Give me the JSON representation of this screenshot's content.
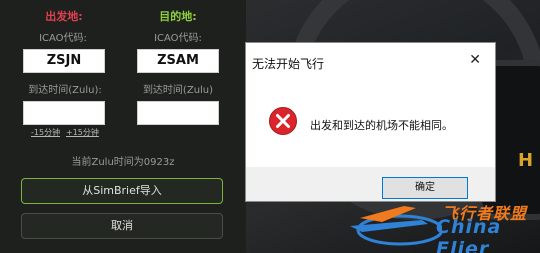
{
  "departure": {
    "heading": "出发地:",
    "icao_label": "ICAO代码:",
    "icao_value": "ZSJN",
    "arrival_time_label": "到达时间(Zulu):",
    "arrival_time_value": "",
    "minus_15": "-15分钟",
    "plus_15": "+15分钟"
  },
  "destination": {
    "heading": "目的地:",
    "icao_label": "ICAO代码:",
    "icao_value": "ZSAM",
    "arrival_time_label": "到达时间(Zulu)",
    "arrival_time_value": ""
  },
  "current_time": "当前Zulu时间为0923z",
  "import_button": "从SimBrief导入",
  "cancel_button": "取消",
  "dialog": {
    "title": "无法开始飞行",
    "message": "出发和到达的机场不能相同。",
    "ok_button": "确定"
  },
  "colors": {
    "departure_heading": "#e0404e",
    "destination_heading": "#8fcf3c",
    "import_border": "#7fb23a",
    "error_red": "#d9252b",
    "ok_focus": "#0078d7"
  },
  "icons": {
    "error": "error-x-icon",
    "close": "close-icon"
  }
}
